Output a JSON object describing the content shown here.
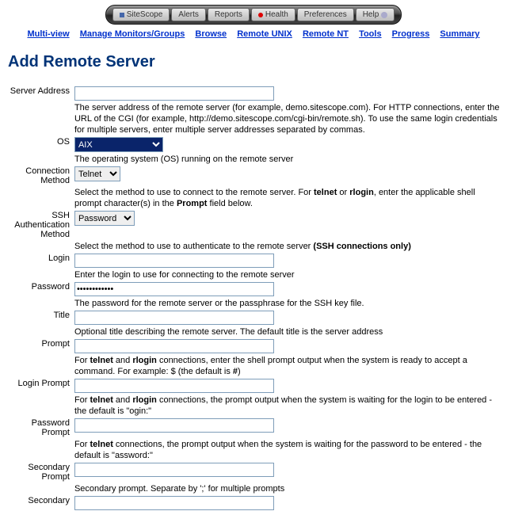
{
  "toolbar": {
    "sitescope": "SiteScope",
    "alerts": "Alerts",
    "reports": "Reports",
    "health": "Health",
    "preferences": "Preferences",
    "help": "Help"
  },
  "linkbar": {
    "multiview": "Multi-view",
    "manage": "Manage Monitors/Groups",
    "browse": "Browse",
    "remoteunix": "Remote UNIX",
    "remotent": "Remote NT",
    "tools": "Tools",
    "progress": "Progress",
    "summary": "Summary"
  },
  "page_title": "Add Remote Server",
  "fields": {
    "server_address": {
      "label": "Server Address",
      "value": "",
      "help": "The server address of the remote server (for example, demo.sitescope.com). For HTTP connections, enter the URL of the CGI (for example, http://demo.sitescope.com/cgi-bin/remote.sh). To use the same login credentials for multiple servers, enter multiple server addresses separated by commas."
    },
    "os": {
      "label": "OS",
      "value": "AIX",
      "help": "The operating system (OS) running on the remote server"
    },
    "connection_method": {
      "label": "Connection Method",
      "value": "Telnet",
      "help_pre": "Select the method to use to connect to the remote server. For ",
      "help_b1": "telnet",
      "help_mid": " or ",
      "help_b2": "rlogin",
      "help_post": ", enter the applicable shell prompt character(s) in the ",
      "help_b3": "Prompt",
      "help_end": " field below."
    },
    "ssh_auth": {
      "label": "SSH Authentication Method",
      "value": "Password",
      "help_pre": "Select the method to use to authenticate to the remote server ",
      "help_b": "(SSH connections only)"
    },
    "login": {
      "label": "Login",
      "value": "",
      "help": "Enter the login to use for connecting to the remote server"
    },
    "password": {
      "label": "Password",
      "value": "************",
      "help": "The password for the remote server or the passphrase for the SSH key file."
    },
    "title": {
      "label": "Title",
      "value": "",
      "help": "Optional title describing the remote server. The default title is the server address"
    },
    "prompt": {
      "label": "Prompt",
      "value": "",
      "help_pre": "For ",
      "help_b1": "telnet",
      "help_mid": " and ",
      "help_b2": "rlogin",
      "help_post": " connections, enter the shell prompt output when the system is ready to accept a command. For example: $ (the default is ",
      "help_b3": "#",
      "help_end": ")"
    },
    "login_prompt": {
      "label": "Login Prompt",
      "value": "",
      "help_pre": "For ",
      "help_b1": "telnet",
      "help_mid": " and ",
      "help_b2": "rlogin",
      "help_post": " connections, the prompt output when the system is waiting for the login to be entered - the default is \"ogin:\""
    },
    "password_prompt": {
      "label": "Password Prompt",
      "value": "",
      "help_pre": "For ",
      "help_b1": "telnet",
      "help_post": " connections, the prompt output when the system is waiting for the password to be entered - the default is \"assword:\""
    },
    "secondary_prompt": {
      "label": "Secondary Prompt",
      "value": "",
      "help": "Secondary prompt. Separate by ';' for multiple prompts"
    },
    "secondary": {
      "label": "Secondary"
    }
  }
}
